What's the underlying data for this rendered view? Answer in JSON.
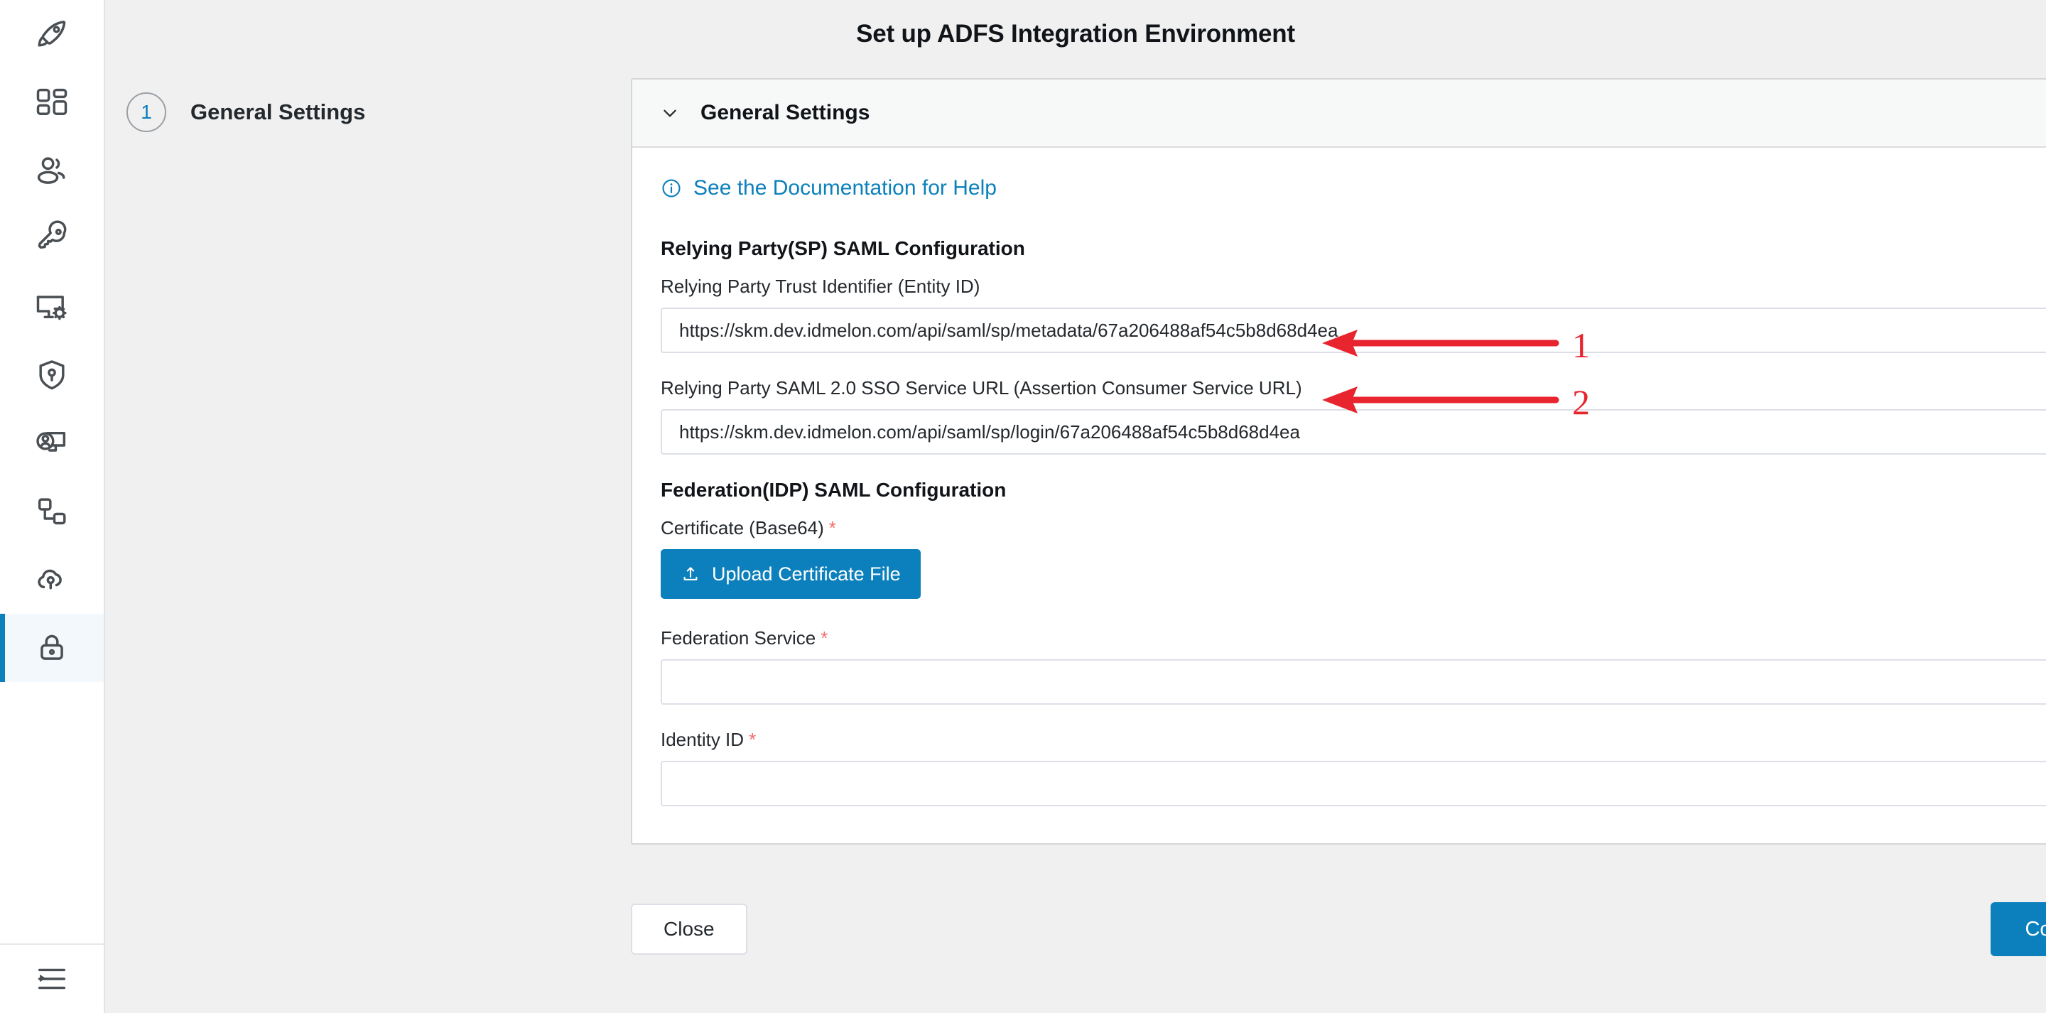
{
  "page": {
    "title": "Set up ADFS Integration Environment",
    "accent_color": "#0c80bc",
    "required_color": "#f56c6c",
    "annotation_color": "#e8252f"
  },
  "sidebar": {
    "items": [
      {
        "icon": "rocket-icon",
        "active": false
      },
      {
        "icon": "dashboard-grid-icon",
        "active": false
      },
      {
        "icon": "users-icon",
        "active": false
      },
      {
        "icon": "key-icon",
        "active": false
      },
      {
        "icon": "monitor-settings-icon",
        "active": false
      },
      {
        "icon": "shield-key-icon",
        "active": false
      },
      {
        "icon": "user-screen-icon",
        "active": false
      },
      {
        "icon": "sitemap-icon",
        "active": false
      },
      {
        "icon": "cloud-key-icon",
        "active": false
      },
      {
        "icon": "lock-icon",
        "active": true
      }
    ],
    "collapse_toggle": {
      "icon": "collapse-menu-icon"
    }
  },
  "stepper": {
    "steps": [
      {
        "number": "1",
        "label": "General Settings"
      }
    ]
  },
  "card": {
    "header": {
      "title": "General Settings",
      "chevron": "chevron-down-icon"
    },
    "doc_link": {
      "icon": "info-circle-icon",
      "label": "See the Documentation for Help"
    },
    "sections": [
      {
        "title": "Relying Party(SP) SAML Configuration",
        "fields": [
          {
            "label": "Relying Party Trust Identifier (Entity ID)",
            "required": false,
            "value": "https://skm.dev.idmelon.com/api/saml/sp/metadata/67a206488af54c5b8d68d4ea",
            "placeholder": "",
            "copy_icon": "copy-icon"
          },
          {
            "label": "Relying Party SAML 2.0 SSO Service URL (Assertion Consumer Service URL)",
            "required": false,
            "value": "https://skm.dev.idmelon.com/api/saml/sp/login/67a206488af54c5b8d68d4ea",
            "placeholder": "",
            "copy_icon": "copy-icon"
          }
        ]
      },
      {
        "title": "Federation(IDP) SAML Configuration",
        "certificate": {
          "label": "Certificate (Base64)",
          "required": true,
          "upload_button": {
            "label": "Upload Certificate File",
            "icon": "upload-icon"
          }
        },
        "fields": [
          {
            "label": "Federation Service",
            "required": true,
            "value": "",
            "placeholder": "",
            "copy_icon": "copy-icon"
          },
          {
            "label": "Identity ID",
            "required": true,
            "value": "",
            "placeholder": "",
            "copy_icon": "copy-icon"
          }
        ]
      }
    ]
  },
  "footer": {
    "close_label": "Close",
    "confirm_label": "Confirm"
  },
  "annotations": [
    {
      "number": "1",
      "points_to": "entity-id-input"
    },
    {
      "number": "2",
      "points_to": "sso-service-url-input"
    }
  ]
}
